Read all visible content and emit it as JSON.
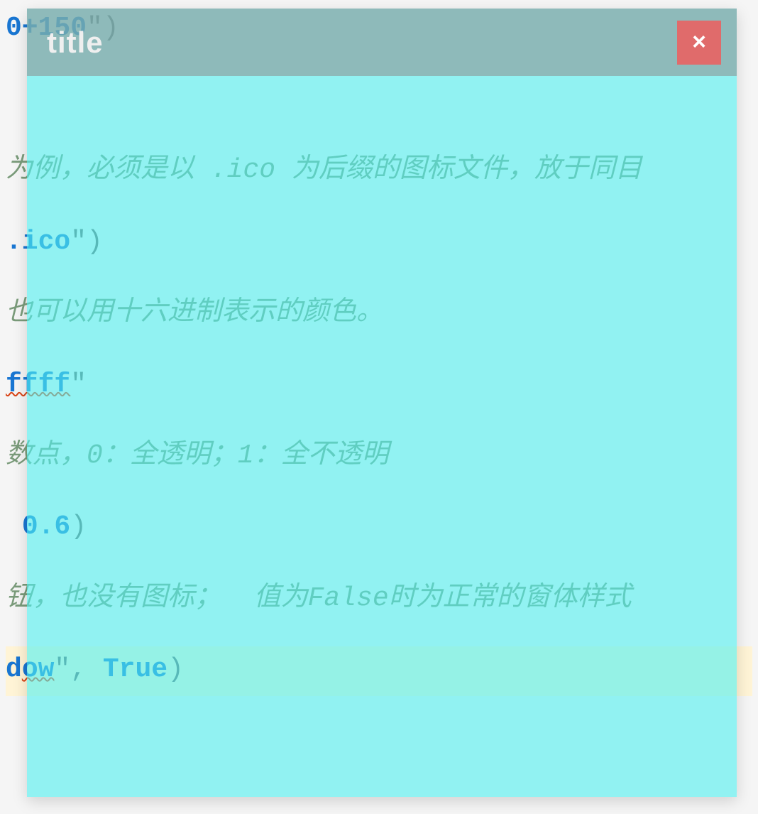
{
  "window": {
    "title": "title",
    "close_label": "×"
  },
  "code": {
    "line1_a": "0+150",
    "line1_b": "\")",
    "comment1_a": "为例，必须是以 ",
    "comment1_b": ".ico",
    "comment1_c": " 为后缀的图标文件，放于同目",
    "line2_a": ".ico",
    "line2_b": "\")",
    "comment2": "也可以用十六进制表示的颜色。",
    "line3_a": "ffff",
    "line3_b": "\"",
    "comment3": "数点，0：全透明；1：全不透明",
    "line4_a": " ",
    "line4_b": "0.6",
    "line4_c": ")",
    "comment4": "钮，也没有图标；  值为False时为正常的窗体样式",
    "line5_a": "d",
    "line5_b": "ow",
    "line5_c": "\", ",
    "line5_d": "True",
    "line5_e": ")"
  }
}
